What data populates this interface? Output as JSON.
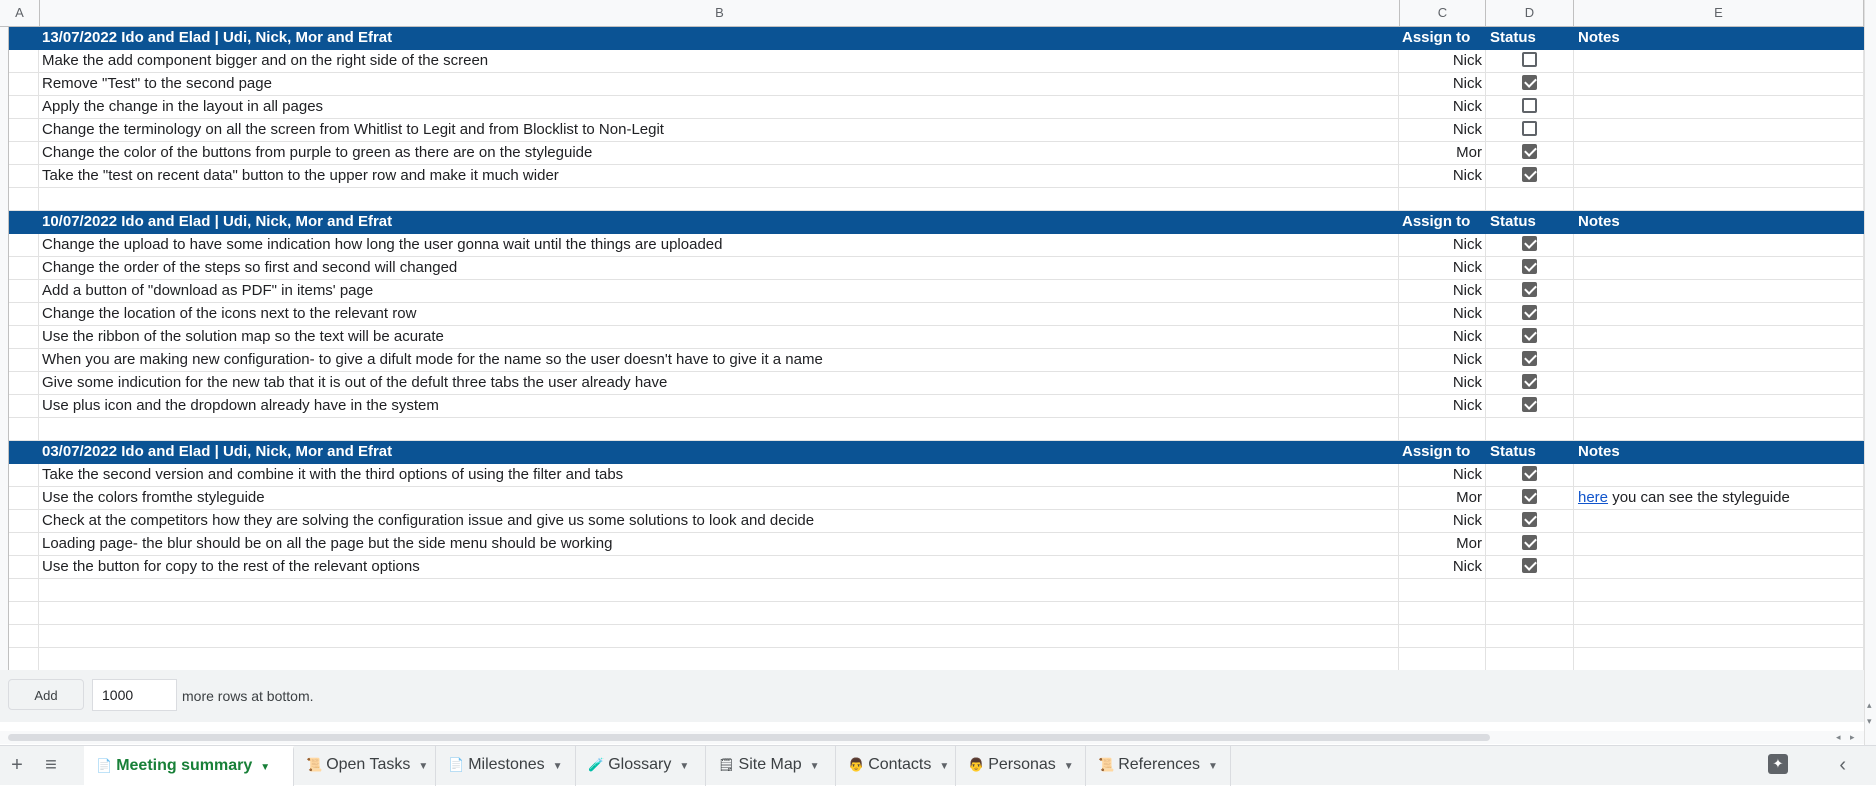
{
  "columns": [
    "A",
    "B",
    "C",
    "D",
    "E"
  ],
  "sections": [
    {
      "header": {
        "title": "13/07/2022  Ido and Elad | Udi, Nick, Mor and Efrat",
        "assign": "Assign to",
        "status": "Status",
        "notes": "Notes"
      },
      "rows": [
        {
          "task": "Make the add component bigger and on the right side of the screen",
          "assignee": "Nick",
          "done": false
        },
        {
          "task": "Remove \"Test\" to the second page",
          "assignee": "Nick",
          "done": true
        },
        {
          "task": " Apply the change in the layout in all pages",
          "assignee": "Nick",
          "done": false
        },
        {
          "task": " Change the terminology on all the screen from Whitlist to Legit and from Blocklist to Non-Legit",
          "assignee": "Nick",
          "done": false
        },
        {
          "task": "Change the color of the buttons from purple to green as there are on the styleguide",
          "assignee": "Mor",
          "done": true
        },
        {
          "task": "Take the \"test on recent data\" button to the upper row and make it much wider",
          "assignee": "Nick",
          "done": true
        }
      ]
    },
    {
      "header": {
        "title": "10/07/2022  Ido and Elad | Udi, Nick, Mor and Efrat",
        "assign": "Assign to",
        "status": "Status",
        "notes": "Notes"
      },
      "rows": [
        {
          "task": "Change the upload to have some indication how long the user gonna wait until the things are uploaded",
          "assignee": "Nick",
          "done": true
        },
        {
          "task": "Change the order of the steps so first and second will changed",
          "assignee": "Nick",
          "done": true
        },
        {
          "task": "Add a button of \"download as PDF\" in items' page",
          "assignee": "Nick",
          "done": true
        },
        {
          "task": "Change the location of the icons next to the relevant row",
          "assignee": "Nick",
          "done": true
        },
        {
          "task": "Use the ribbon of the solution map so the text will be acurate",
          "assignee": "Nick",
          "done": true
        },
        {
          "task": "When you are making new configuration- to give a difult mode for the name so the user doesn't have to give it a name",
          "assignee": "Nick",
          "done": true
        },
        {
          "task": "Give some indicution for the new tab that it is out of the defult three tabs the user already have",
          "assignee": "Nick",
          "done": true
        },
        {
          "task": "Use plus icon and the dropdown already have in the system",
          "assignee": "Nick",
          "done": true
        }
      ]
    },
    {
      "header": {
        "title": "03/07/2022  Ido and Elad | Udi, Nick, Mor and Efrat",
        "assign": "Assign to",
        "status": "Status",
        "notes": "Notes"
      },
      "rows": [
        {
          "task": "Take the second version and combine it with the third options of using the filter and tabs",
          "assignee": "Nick",
          "done": true
        },
        {
          "task": "Use the colors fromthe styleguide",
          "assignee": "Mor",
          "done": true,
          "note_link": "here",
          "note_text": " you can see the styleguide"
        },
        {
          "task": "Check at the competitors how they are solving the configuration issue and give us some solutions to look and decide",
          "assignee": "Nick",
          "done": true
        },
        {
          "task": "Loading page- the blur should be on all the page but the side menu should be working",
          "assignee": "Mor",
          "done": true
        },
        {
          "task": "Use the button for copy to the rest of the relevant options",
          "assignee": "Nick",
          "done": true
        }
      ]
    }
  ],
  "add_rows": {
    "button": "Add",
    "count": "1000",
    "suffix": "more rows at bottom."
  },
  "tabs": [
    {
      "label": "Meeting summary",
      "icon": "📄",
      "active": true
    },
    {
      "label": "Open Tasks",
      "icon": "📜",
      "active": false
    },
    {
      "label": "Milestones",
      "icon": "📄",
      "active": false
    },
    {
      "label": "Glossary",
      "icon": "🧪",
      "active": false
    },
    {
      "label": "Site Map",
      "icon": "🗒",
      "active": false
    },
    {
      "label": "Contacts",
      "icon": "👨",
      "active": false
    },
    {
      "label": "Personas",
      "icon": "👨",
      "active": false
    },
    {
      "label": "References",
      "icon": "📜",
      "active": false
    }
  ],
  "colors": {
    "header_bg": "#0b5394",
    "active_tab": "#188038",
    "checkbox": "#616161"
  }
}
